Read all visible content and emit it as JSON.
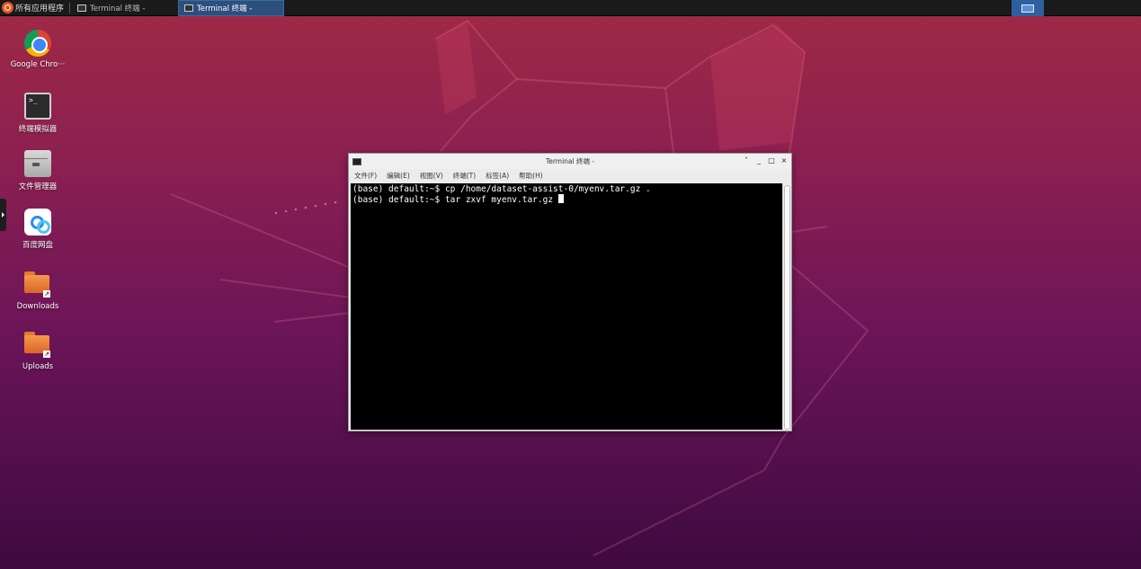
{
  "taskbar": {
    "start_label": "所有应用程序",
    "tasks": [
      {
        "label": "Terminal 终端 -",
        "active": false
      },
      {
        "label": "Terminal 终端 -",
        "active": true
      }
    ]
  },
  "desktop": {
    "icons": [
      {
        "label": "Google Chro···",
        "icon": "chrome-icon"
      },
      {
        "label": "终端模拟器",
        "icon": "terminal-icon"
      },
      {
        "label": "文件管理器",
        "icon": "file-manager-icon"
      },
      {
        "label": "百度网盘",
        "icon": "baidu-netdisk-icon"
      },
      {
        "label": "Downloads",
        "icon": "folder-icon"
      },
      {
        "label": "Uploads",
        "icon": "folder-icon"
      }
    ]
  },
  "terminal": {
    "title": "Terminal 终端 -",
    "controls": {
      "up": "˄",
      "min": "_",
      "max": "□",
      "close": "×"
    },
    "menu": [
      "文件(F)",
      "编辑(E)",
      "视图(V)",
      "终端(T)",
      "标签(A)",
      "帮助(H)"
    ],
    "lines": [
      "(base) default:~$ cp /home/dataset-assist-0/myenv.tar.gz .",
      "(base) default:~$ tar zxvf myenv.tar.gz "
    ]
  },
  "colors": {
    "wallpaper_top": "#a02a45",
    "wallpaper_bottom": "#3e0a40",
    "taskbar": "#1a1a1a",
    "active_task": "#2c4f7c"
  }
}
